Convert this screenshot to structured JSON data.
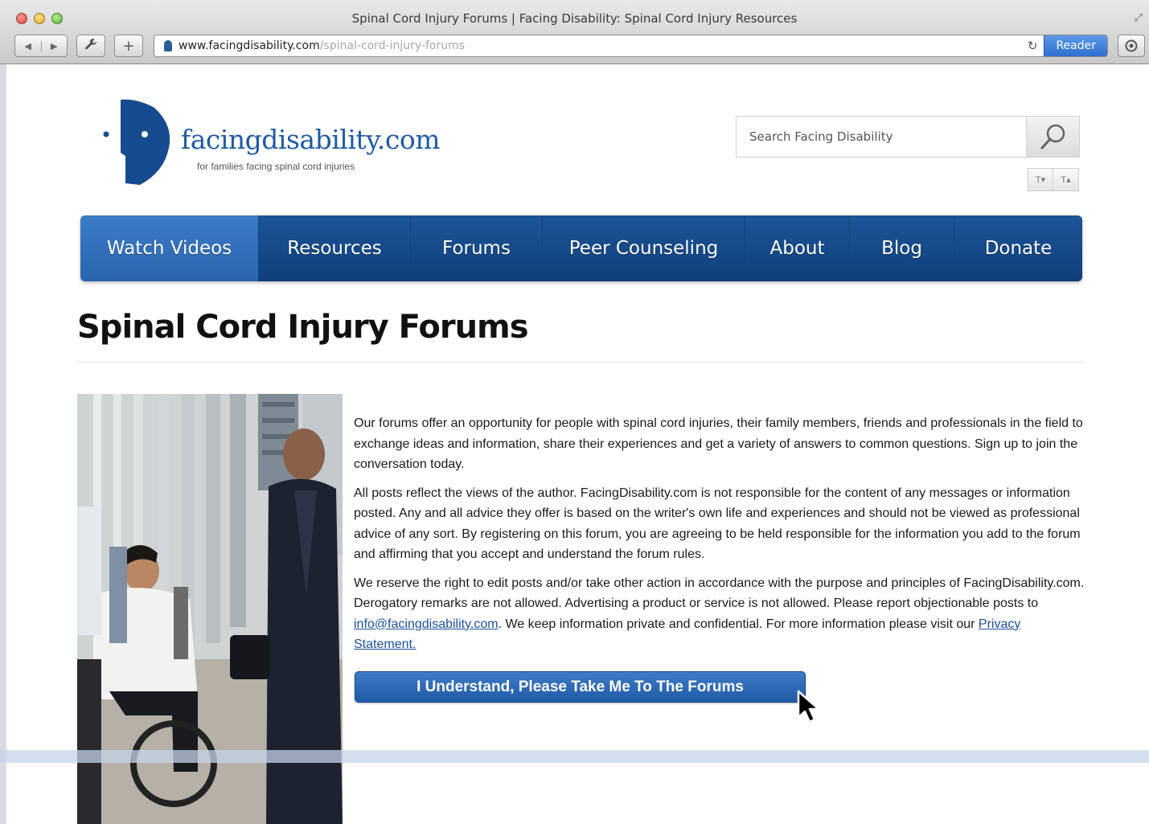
{
  "window": {
    "title": "Spinal Cord Injury Forums | Facing Disability: Spinal Cord Injury Resources"
  },
  "toolbar": {
    "back_icon": "back-arrow-icon",
    "forward_icon": "forward-arrow-icon",
    "tools_icon": "wrench-icon",
    "new_tab_label": "+",
    "reader_label": "Reader",
    "downloads_icon": "downloads-icon"
  },
  "address": {
    "host": "www.facingdisability.com",
    "path": "/spinal-cord-injury-forums"
  },
  "site": {
    "logo_name": "facingdisability.com",
    "tagline": "for families facing spinal cord injuries",
    "brand_color": "#1f5aa6"
  },
  "search": {
    "placeholder": "Search Facing Disability",
    "icon": "search-icon"
  },
  "text_size": {
    "decrease_label": "T▾",
    "increase_label": "T▴"
  },
  "nav": {
    "items": [
      {
        "label": "Watch Videos",
        "active": true
      },
      {
        "label": "Resources"
      },
      {
        "label": "Forums"
      },
      {
        "label": "Peer Counseling"
      },
      {
        "label": "About"
      },
      {
        "label": "Blog"
      },
      {
        "label": "Donate"
      }
    ]
  },
  "main": {
    "title": "Spinal Cord Injury Forums",
    "paragraph1": "Our forums offer an opportunity for people with spinal cord injuries, their family members, friends and professionals in the field to exchange ideas and information, share their experiences and get a variety of answers to common questions.  Sign up to join the conversation today.",
    "paragraph2": "All posts reflect the views of the author. FacingDisability.com is not responsible for the content of any messages or information posted.  Any and all advice they offer is based on the writer's own life and experiences and should not be viewed as professional advice of any sort. By registering on this forum, you are agreeing to be held responsible for the information you add to the forum and affirming that you accept and understand the forum rules.",
    "paragraph3_a": "We reserve the right to edit posts and/or take other action in accordance with the purpose and principles of FacingDisability.com. Derogatory remarks are not allowed. Advertising a product or service is not allowed. Please report objectionable posts to ",
    "email_link": "info@facingdisability.com",
    "paragraph3_b": ". We keep information private and confidential. For more information please visit our ",
    "privacy_link": "Privacy Statement.",
    "cta_label": "I Understand, Please Take Me To The Forums"
  }
}
